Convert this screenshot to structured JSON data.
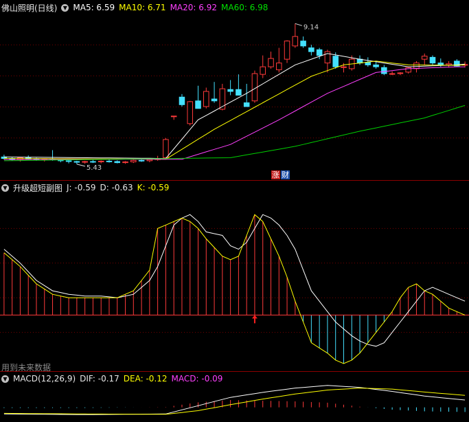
{
  "main_chart": {
    "title": "佛山照明(日线)",
    "indicators": [
      {
        "label": "MA5: 6.59",
        "color": "#ffffff"
      },
      {
        "label": "MA10: 6.71",
        "color": "#ffff00"
      },
      {
        "label": "MA20: 6.92",
        "color": "#ff40ff"
      },
      {
        "label": "MA60: 6.98",
        "color": "#00e000"
      }
    ],
    "high_label": "9.14",
    "low_label": "5.43",
    "badges": [
      "涨",
      "财"
    ]
  },
  "kdj_chart": {
    "title": "升级超短副图",
    "indicators": [
      {
        "label": "J: -0.59",
        "color": "#e8e8e8"
      },
      {
        "label": "D: -0.63",
        "color": "#e8e8e8"
      },
      {
        "label": "K: -0.59",
        "color": "#ffff00"
      }
    ],
    "footnote": "用到未来数据"
  },
  "macd_chart": {
    "title": "MACD(12,26,9)",
    "indicators": [
      {
        "label": "DIF: -0.17",
        "color": "#e8e8e8"
      },
      {
        "label": "DEA: -0.12",
        "color": "#ffff00"
      },
      {
        "label": "MACD: -0.09",
        "color": "#ff40ff"
      }
    ]
  },
  "colors": {
    "up": "#ff3a3a",
    "down": "#44e0ff",
    "ma5": "#ffffff",
    "ma10": "#ffff00",
    "ma20": "#ff40ff",
    "ma60": "#00d000",
    "grid": "#7a0000"
  },
  "chart_data": [
    {
      "type": "candlestick",
      "title": "佛山照明(日线)",
      "candles": [
        {
          "o": 5.62,
          "h": 5.68,
          "l": 5.55,
          "c": 5.58
        },
        {
          "o": 5.58,
          "h": 5.62,
          "l": 5.52,
          "c": 5.55
        },
        {
          "o": 5.55,
          "h": 5.62,
          "l": 5.5,
          "c": 5.6
        },
        {
          "o": 5.6,
          "h": 5.66,
          "l": 5.55,
          "c": 5.57
        },
        {
          "o": 5.57,
          "h": 5.6,
          "l": 5.52,
          "c": 5.55
        },
        {
          "o": 5.55,
          "h": 5.58,
          "l": 5.5,
          "c": 5.56
        },
        {
          "o": 5.56,
          "h": 5.8,
          "l": 5.52,
          "c": 5.55
        },
        {
          "o": 5.55,
          "h": 5.58,
          "l": 5.48,
          "c": 5.52
        },
        {
          "o": 5.52,
          "h": 5.55,
          "l": 5.45,
          "c": 5.5
        },
        {
          "o": 5.5,
          "h": 5.52,
          "l": 5.43,
          "c": 5.48
        },
        {
          "o": 5.48,
          "h": 5.52,
          "l": 5.44,
          "c": 5.5
        },
        {
          "o": 5.5,
          "h": 5.54,
          "l": 5.46,
          "c": 5.49
        },
        {
          "o": 5.49,
          "h": 5.53,
          "l": 5.45,
          "c": 5.51
        },
        {
          "o": 5.51,
          "h": 5.55,
          "l": 5.47,
          "c": 5.5
        },
        {
          "o": 5.5,
          "h": 5.53,
          "l": 5.45,
          "c": 5.47
        },
        {
          "o": 5.47,
          "h": 5.51,
          "l": 5.44,
          "c": 5.49
        },
        {
          "o": 5.49,
          "h": 5.55,
          "l": 5.46,
          "c": 5.53
        },
        {
          "o": 5.53,
          "h": 5.57,
          "l": 5.49,
          "c": 5.52
        },
        {
          "o": 5.52,
          "h": 5.56,
          "l": 5.48,
          "c": 5.55
        },
        {
          "o": 5.55,
          "h": 5.65,
          "l": 5.52,
          "c": 5.58
        },
        {
          "o": 5.6,
          "h": 6.12,
          "l": 5.58,
          "c": 6.08
        },
        {
          "o": 6.7,
          "h": 6.7,
          "l": 6.6,
          "c": 6.7
        },
        {
          "o": 7.2,
          "h": 7.28,
          "l": 6.95,
          "c": 7.0
        },
        {
          "o": 6.5,
          "h": 7.1,
          "l": 6.45,
          "c": 7.08
        },
        {
          "o": 7.1,
          "h": 7.5,
          "l": 6.9,
          "c": 6.9
        },
        {
          "o": 6.95,
          "h": 7.45,
          "l": 6.9,
          "c": 7.35
        },
        {
          "o": 7.15,
          "h": 7.6,
          "l": 7.05,
          "c": 7.1
        },
        {
          "o": 6.88,
          "h": 7.55,
          "l": 6.85,
          "c": 7.42
        },
        {
          "o": 7.4,
          "h": 7.65,
          "l": 7.25,
          "c": 7.35
        },
        {
          "o": 7.4,
          "h": 7.8,
          "l": 7.35,
          "c": 7.25
        },
        {
          "o": 7.05,
          "h": 7.55,
          "l": 7.0,
          "c": 6.95
        },
        {
          "o": 7.1,
          "h": 7.9,
          "l": 7.05,
          "c": 7.82
        },
        {
          "o": 7.8,
          "h": 8.3,
          "l": 7.7,
          "c": 8.0
        },
        {
          "o": 8.0,
          "h": 8.4,
          "l": 7.95,
          "c": 8.22
        },
        {
          "o": 7.92,
          "h": 8.5,
          "l": 7.85,
          "c": 8.1
        },
        {
          "o": 8.2,
          "h": 8.7,
          "l": 8.1,
          "c": 8.68
        },
        {
          "o": 8.55,
          "h": 9.14,
          "l": 8.5,
          "c": 8.8
        },
        {
          "o": 8.68,
          "h": 8.8,
          "l": 8.5,
          "c": 8.55
        },
        {
          "o": 8.5,
          "h": 8.58,
          "l": 8.3,
          "c": 8.4
        },
        {
          "o": 8.45,
          "h": 8.5,
          "l": 8.2,
          "c": 8.3
        },
        {
          "o": 8.1,
          "h": 8.45,
          "l": 7.85,
          "c": 8.4
        },
        {
          "o": 8.28,
          "h": 8.38,
          "l": 7.95,
          "c": 8.0
        },
        {
          "o": 7.98,
          "h": 8.1,
          "l": 7.85,
          "c": 8.0
        },
        {
          "o": 7.95,
          "h": 8.3,
          "l": 7.9,
          "c": 8.2
        },
        {
          "o": 8.2,
          "h": 8.3,
          "l": 8.05,
          "c": 8.1
        },
        {
          "o": 8.12,
          "h": 8.25,
          "l": 8.0,
          "c": 8.05
        },
        {
          "o": 8.05,
          "h": 8.15,
          "l": 7.95,
          "c": 8.0
        },
        {
          "o": 7.98,
          "h": 8.05,
          "l": 7.78,
          "c": 7.82
        },
        {
          "o": 7.82,
          "h": 7.88,
          "l": 7.78,
          "c": 7.82
        },
        {
          "o": 7.82,
          "h": 7.86,
          "l": 7.78,
          "c": 7.84
        },
        {
          "o": 7.86,
          "h": 8.0,
          "l": 7.82,
          "c": 7.98
        },
        {
          "o": 7.95,
          "h": 8.15,
          "l": 7.85,
          "c": 8.1
        },
        {
          "o": 8.2,
          "h": 8.35,
          "l": 8.05,
          "c": 8.28
        },
        {
          "o": 8.25,
          "h": 8.3,
          "l": 8.05,
          "c": 8.1
        },
        {
          "o": 8.1,
          "h": 8.22,
          "l": 8.0,
          "c": 8.05
        },
        {
          "o": 8.05,
          "h": 8.15,
          "l": 7.98,
          "c": 8.08
        },
        {
          "o": 8.15,
          "h": 8.2,
          "l": 8.0,
          "c": 8.02
        },
        {
          "o": 8.06,
          "h": 8.14,
          "l": 7.98,
          "c": 8.06
        }
      ],
      "ma": {
        "ma5": [
          [
            0,
            5.62
          ],
          [
            20,
            5.58
          ],
          [
            24,
            6.6
          ],
          [
            30,
            7.3
          ],
          [
            36,
            8.05
          ],
          [
            40,
            8.35
          ],
          [
            44,
            8.2
          ],
          [
            50,
            8.0
          ],
          [
            56,
            8.05
          ],
          [
            57,
            8.07
          ]
        ],
        "ma10": [
          [
            0,
            5.58
          ],
          [
            20,
            5.56
          ],
          [
            26,
            6.35
          ],
          [
            32,
            7.05
          ],
          [
            38,
            7.75
          ],
          [
            42,
            8.05
          ],
          [
            46,
            8.15
          ],
          [
            50,
            8.05
          ],
          [
            56,
            8.04
          ],
          [
            57,
            8.05
          ]
        ],
        "ma20": [
          [
            0,
            5.55
          ],
          [
            22,
            5.56
          ],
          [
            28,
            5.95
          ],
          [
            34,
            6.6
          ],
          [
            40,
            7.3
          ],
          [
            46,
            7.85
          ],
          [
            50,
            7.95
          ],
          [
            56,
            8.0
          ],
          [
            57,
            8.0
          ]
        ],
        "ma60": [
          [
            0,
            5.52
          ],
          [
            28,
            5.6
          ],
          [
            36,
            5.9
          ],
          [
            44,
            6.3
          ],
          [
            52,
            6.65
          ],
          [
            57,
            6.98
          ]
        ]
      },
      "ylim": [
        5.3,
        9.4
      ]
    },
    {
      "type": "line",
      "title": "升级超短副图",
      "x": [
        0,
        2,
        4,
        6,
        8,
        10,
        12,
        14,
        16,
        18,
        19,
        21,
        22,
        23,
        24,
        25,
        27,
        28,
        29,
        30,
        31,
        32,
        33,
        34,
        35,
        36,
        37,
        38,
        40,
        41,
        42,
        43,
        44,
        45,
        46,
        47,
        48,
        49,
        50,
        51,
        52,
        53,
        54,
        55,
        56,
        57
      ],
      "series": [
        {
          "name": "K",
          "values": [
            68,
            60,
            50,
            44,
            42,
            41,
            41,
            40,
            42,
            50,
            58,
            82,
            86,
            88,
            84,
            78,
            76,
            70,
            68,
            72,
            80,
            88,
            86,
            82,
            76,
            68,
            56,
            44,
            32,
            26,
            22,
            18,
            15,
            13,
            12,
            14,
            20,
            26,
            32,
            38,
            44,
            46,
            44,
            42,
            40,
            38
          ]
        },
        {
          "name": "J",
          "values": [
            66,
            58,
            48,
            42,
            40,
            40,
            40,
            40,
            44,
            56,
            80,
            84,
            86,
            84,
            80,
            74,
            64,
            62,
            64,
            76,
            88,
            84,
            74,
            64,
            52,
            38,
            26,
            14,
            8,
            4,
            2,
            4,
            8,
            14,
            20,
            26,
            32,
            40,
            46,
            48,
            44,
            42,
            38,
            34,
            32,
            30
          ]
        }
      ],
      "ylim": [
        0,
        100
      ]
    },
    {
      "type": "line",
      "title": "MACD(12,26,9)",
      "x": [
        0,
        10,
        20,
        24,
        28,
        32,
        36,
        40,
        44,
        48,
        52,
        57
      ],
      "series": [
        {
          "name": "DIF",
          "values": [
            -0.2,
            -0.22,
            -0.2,
            0.05,
            0.3,
            0.45,
            0.58,
            0.66,
            0.6,
            0.48,
            0.34,
            0.22
          ]
        },
        {
          "name": "DEA",
          "values": [
            -0.18,
            -0.2,
            -0.21,
            -0.1,
            0.08,
            0.25,
            0.4,
            0.52,
            0.58,
            0.55,
            0.46,
            0.36
          ]
        },
        {
          "name": "MACD",
          "values": [
            -0.02,
            -0.02,
            0.01,
            0.15,
            0.22,
            0.2,
            0.18,
            0.14,
            0.02,
            -0.07,
            -0.12,
            -0.14
          ]
        }
      ],
      "ylim": [
        -0.4,
        0.8
      ]
    }
  ]
}
